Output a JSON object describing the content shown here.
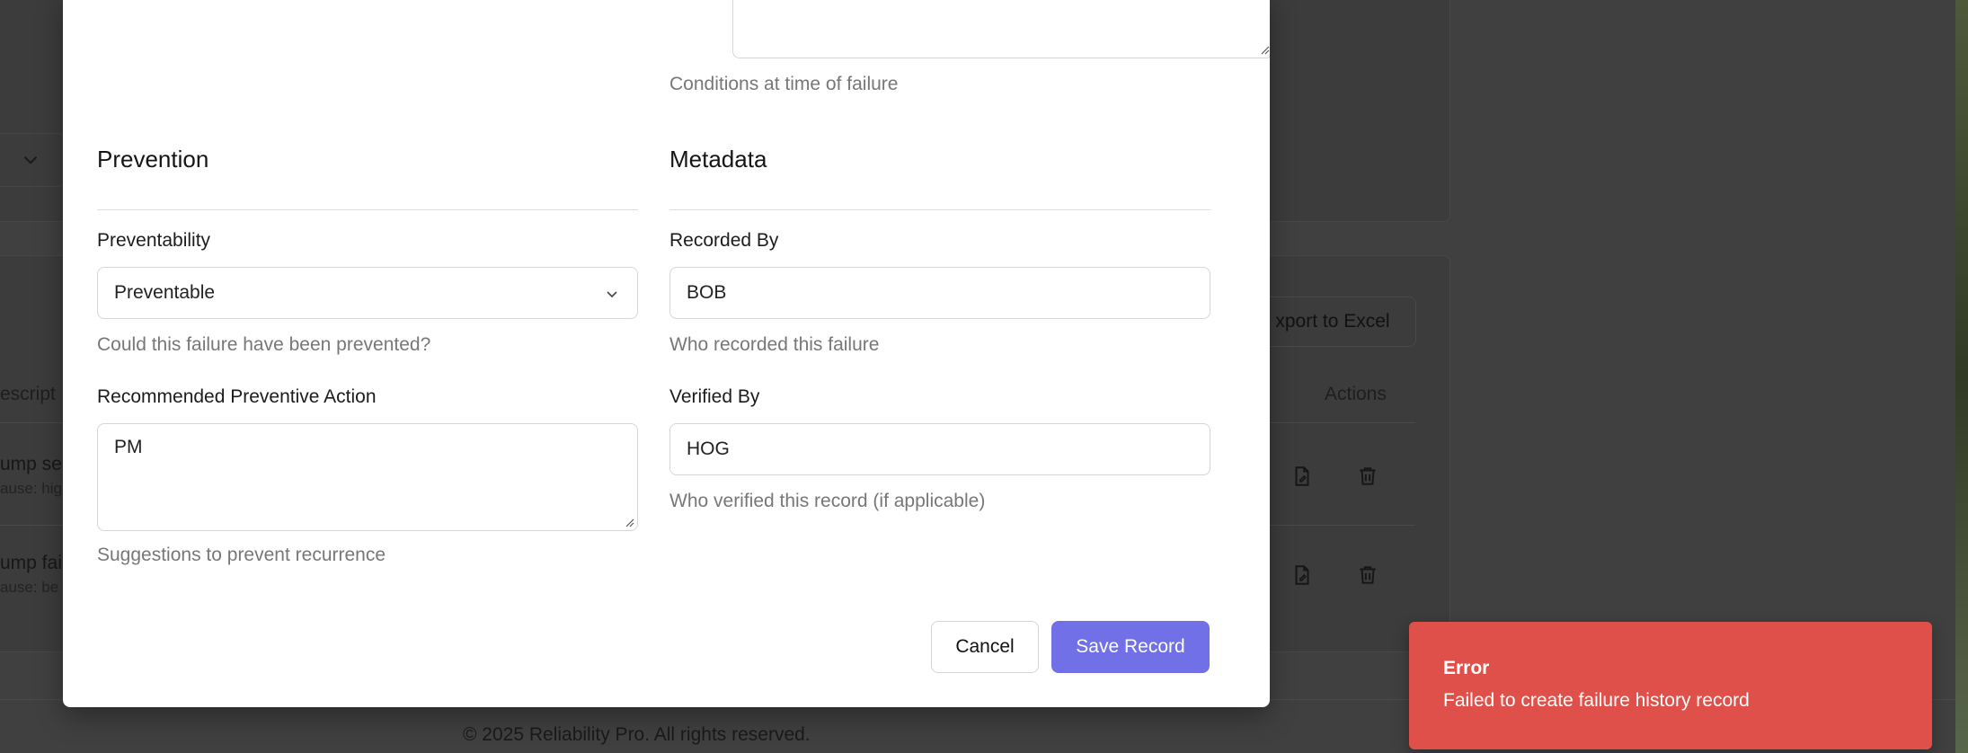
{
  "background": {
    "export_label": "xport to Excel",
    "actions_header": "Actions",
    "descr_header": "escript",
    "rows": [
      {
        "title": "ump se",
        "sub": "ause: hig"
      },
      {
        "title": "ump fai",
        "sub": "ause: be"
      }
    ],
    "footer": "© 2025 Reliability Pro. All rights reserved."
  },
  "modal": {
    "conditions_help": "Conditions at time of failure",
    "prevention": {
      "title": "Prevention",
      "preventability_label": "Preventability",
      "preventability_value": "Preventable",
      "preventability_help": "Could this failure have been prevented?",
      "action_label": "Recommended Preventive Action",
      "action_value": "PM",
      "action_help": "Suggestions to prevent recurrence"
    },
    "metadata": {
      "title": "Metadata",
      "recorded_label": "Recorded By",
      "recorded_value": "BOB",
      "recorded_help": "Who recorded this failure",
      "verified_label": "Verified By",
      "verified_value": "HOG",
      "verified_help": "Who verified this record (if applicable)"
    },
    "cancel_label": "Cancel",
    "save_label": "Save Record"
  },
  "toast": {
    "title": "Error",
    "message": "Failed to create failure history record",
    "color": "#de5049"
  },
  "colors": {
    "accent": "#7170e6"
  }
}
